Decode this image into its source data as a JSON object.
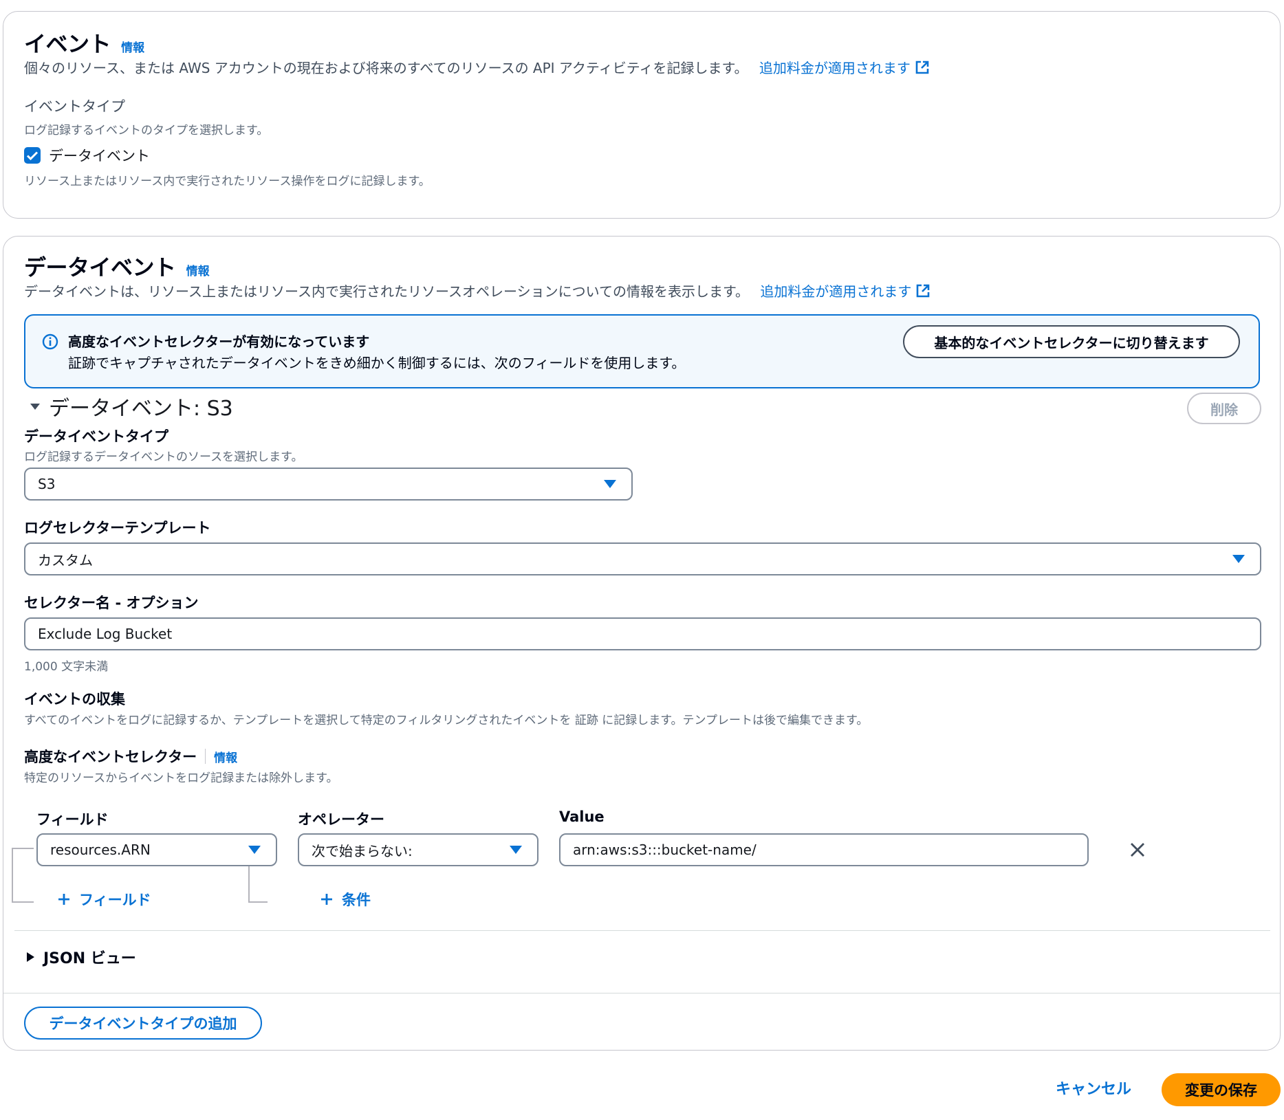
{
  "events_section": {
    "title": "イベント",
    "info": "情報",
    "description": "個々のリソース、または AWS アカウントの現在および将来のすべてのリソースの API アクティビティを記録します。",
    "pricing_link": "追加料金が適用されます",
    "event_type_label": "イベントタイプ",
    "event_type_desc": "ログ記録するイベントのタイプを選択します。",
    "data_event_checkbox_label": "データイベント",
    "data_event_checkbox_checked": true,
    "data_event_checkbox_desc": "リソース上またはリソース内で実行されたリソース操作をログに記録します。"
  },
  "data_events_section": {
    "title": "データイベント",
    "info": "情報",
    "description": "データイベントは、リソース上またはリソース内で実行されたリソースオペレーションについての情報を表示します。",
    "pricing_link": "追加料金が適用されます",
    "alert": {
      "title": "高度なイベントセレクターが有効になっています",
      "body": "証跡でキャプチャされたデータイベントをきめ細かく制御するには、次のフィールドを使用します。",
      "switch_button": "基本的なイベントセレクターに切り替えます"
    },
    "group_title": "データイベント: S3",
    "delete_button": "削除",
    "data_event_type": {
      "label": "データイベントタイプ",
      "desc": "ログ記録するデータイベントのソースを選択します。",
      "value": "S3"
    },
    "log_selector_template": {
      "label": "ログセレクターテンプレート",
      "value": "カスタム"
    },
    "selector_name": {
      "label": "セレクター名 - オプション",
      "value": "Exclude Log Bucket",
      "hint": "1,000 文字未満"
    },
    "event_collection": {
      "label": "イベントの収集",
      "desc": "すべてのイベントをログに記録するか、テンプレートを選択して特定のフィルタリングされたイベントを 証跡 に記録します。テンプレートは後で編集できます。"
    },
    "advanced_selectors": {
      "label": "高度なイベントセレクター",
      "info": "情報",
      "desc": "特定のリソースからイベントをログ記録または除外します。",
      "field_header": "フィールド",
      "operator_header": "オペレーター",
      "value_header": "Value",
      "field_value": "resources.ARN",
      "operator_value": "次で始まらない:",
      "value_value": "arn:aws:s3:::bucket-name/",
      "add_field": "フィールド",
      "add_condition": "条件"
    },
    "json_view": "JSON ビュー",
    "add_type_button": "データイベントタイプの追加"
  },
  "footer": {
    "cancel": "キャンセル",
    "save": "変更の保存"
  },
  "colors": {
    "link": "#0972d3",
    "primary": "#ff9900",
    "alert_bg": "#f2f8fd"
  }
}
